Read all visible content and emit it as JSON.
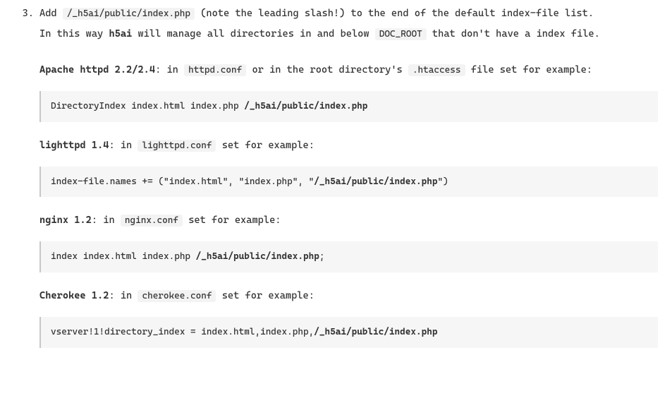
{
  "list_number": "3.",
  "intro": {
    "t1": "Add ",
    "c1": "/_h5ai/public/index.php",
    "t2": " (note the leading slash!) to the end of the default index-file list.",
    "t3": "In this way ",
    "b3": "h5ai",
    "t4": " will manage all directories in and below ",
    "c4": "DOC_ROOT",
    "t5": " that don't have a index file."
  },
  "servers": [
    {
      "name": "Apache httpd 2.2/2.4",
      "pre": ": in ",
      "conf": "httpd.conf",
      "mid": " or in the root directory's ",
      "conf2": ".htaccess",
      "post": " file set for example:",
      "code_a": "DirectoryIndex  index.html  index.php  ",
      "code_b": "/_h5ai/public/index.php"
    },
    {
      "name": "lighttpd 1.4",
      "pre": ": in ",
      "conf": "lighttpd.conf",
      "post": " set for example:",
      "code_a": "index-file.names += (\"index.html\", \"index.php\", \"",
      "code_b": "/_h5ai/public/index.php",
      "code_c": "\")"
    },
    {
      "name": "nginx 1.2",
      "pre": ": in ",
      "conf": "nginx.conf",
      "post": " set for example:",
      "code_a": "index  index.html  index.php  ",
      "code_b": "/_h5ai/public/index.php",
      "code_c": ";"
    },
    {
      "name": "Cherokee 1.2",
      "pre": ": in ",
      "conf": "cherokee.conf",
      "post": " set for example:",
      "code_a": "vserver!1!directory_index = index.html,index.php,",
      "code_b": "/_h5ai/public/index.php"
    }
  ]
}
